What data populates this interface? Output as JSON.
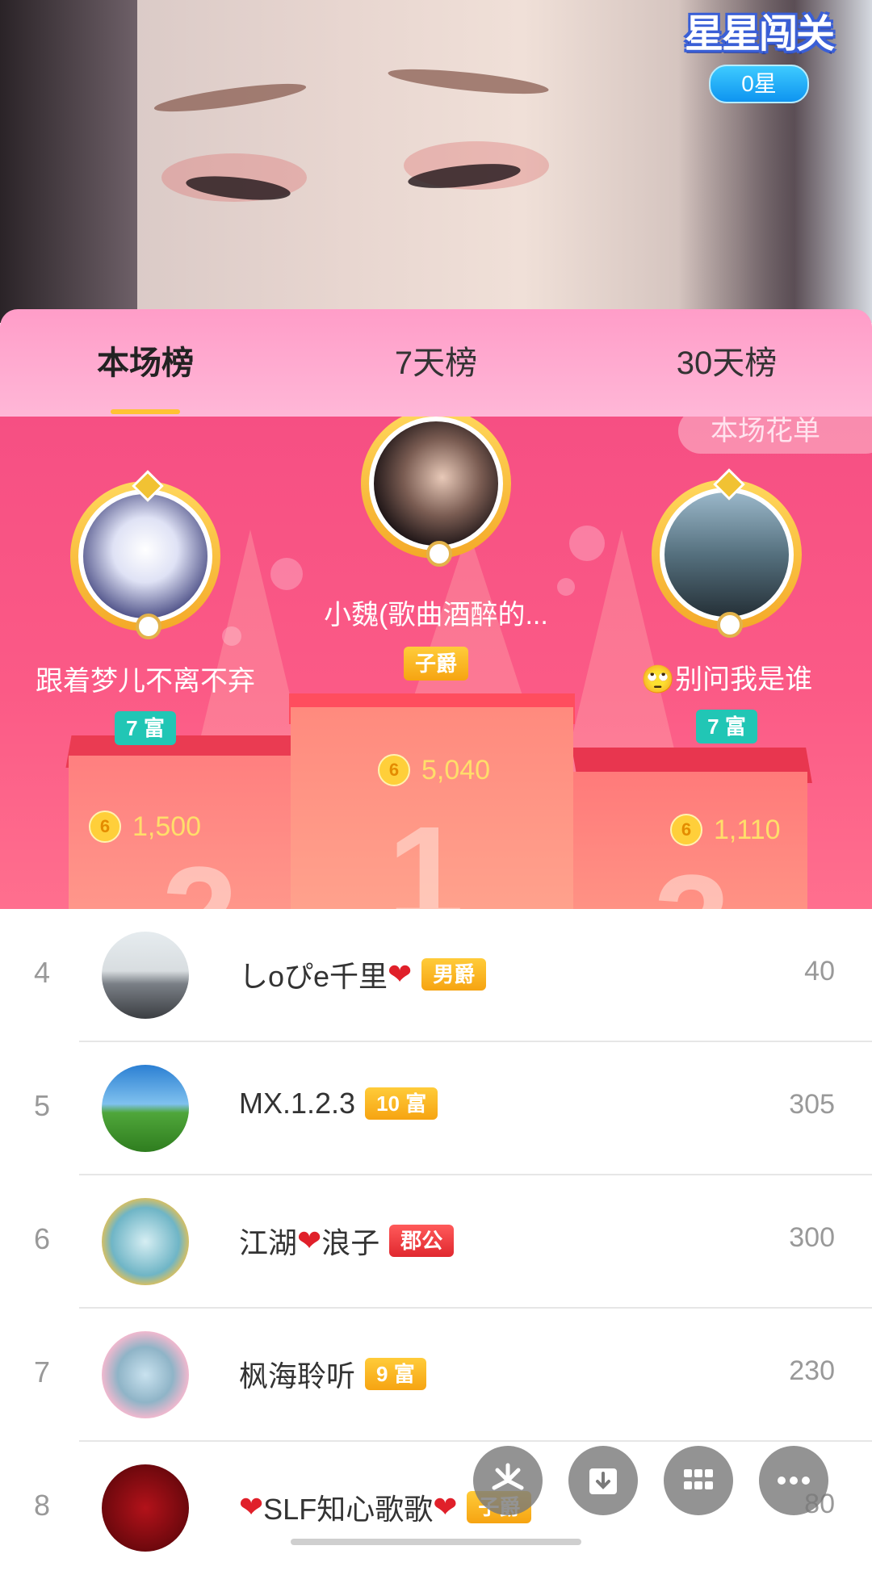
{
  "overlay": {
    "title": "星星闯关",
    "stars": "0星"
  },
  "tabs": [
    {
      "label": "本场榜",
      "active": true
    },
    {
      "label": "7天榜",
      "active": false
    },
    {
      "label": "30天榜",
      "active": false
    }
  ],
  "podium": {
    "corner_tag": "本场花单",
    "first": {
      "name": "小魏(歌曲酒醉的...",
      "badge": "子爵",
      "coins": "5,040",
      "rank": "1"
    },
    "second": {
      "name": "跟着梦儿不离不弃",
      "badge": "7 富",
      "coins": "1,500",
      "rank": "2"
    },
    "third": {
      "name": "🙄别问我是谁",
      "badge": "7 富",
      "coins": "1,110",
      "rank": "3"
    }
  },
  "list": [
    {
      "rank": "4",
      "name": "しoぴe千里",
      "heart": "❤",
      "badge": "男爵",
      "badge_color": "orange",
      "points": "40"
    },
    {
      "rank": "5",
      "name": "MX.1.2.3",
      "badge": "10 富",
      "badge_color": "orange",
      "points": "305"
    },
    {
      "rank": "6",
      "name_a": "江湖",
      "heart": "❤",
      "name_b": "浪子",
      "badge": "郡公",
      "badge_color": "red",
      "points": "300"
    },
    {
      "rank": "7",
      "name": "枫海聆听",
      "badge": "9 富",
      "badge_color": "orange",
      "points": "230"
    },
    {
      "rank": "8",
      "name_a": "SLF知心歌歌",
      "heart": "❤",
      "badge": "子爵",
      "badge_color": "orange",
      "points": "80"
    }
  ],
  "actions": [
    {
      "icon": "share-pinwheel-icon"
    },
    {
      "icon": "download-icon"
    },
    {
      "icon": "grid-icon"
    },
    {
      "icon": "more-icon"
    }
  ],
  "colors": {
    "accent": "#ffc233",
    "podium": "#f64f83",
    "tabs": "#ffa7cd"
  }
}
